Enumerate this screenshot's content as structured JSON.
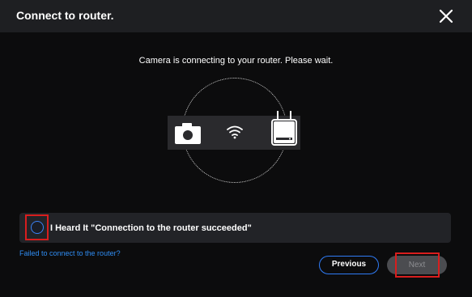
{
  "dialog": {
    "title": "Connect to router.",
    "close_icon": "close-icon"
  },
  "main": {
    "message": "Camera is connecting to your router. Please wait.",
    "icons": [
      "camera-icon",
      "wifi-icon",
      "router-icon"
    ]
  },
  "confirm": {
    "label": "I Heard It \"Connection to the router succeeded\"",
    "checked": false,
    "highlight_color": "#d81e1e"
  },
  "footer": {
    "fail_link": "Failed to connect to the router?",
    "previous_label": "Previous",
    "next_label": "Next",
    "next_enabled": false
  },
  "colors": {
    "accent": "#2f7bf5",
    "link": "#2f8df4",
    "background": "#0c0c0d",
    "titlebar": "#1e1f22"
  }
}
